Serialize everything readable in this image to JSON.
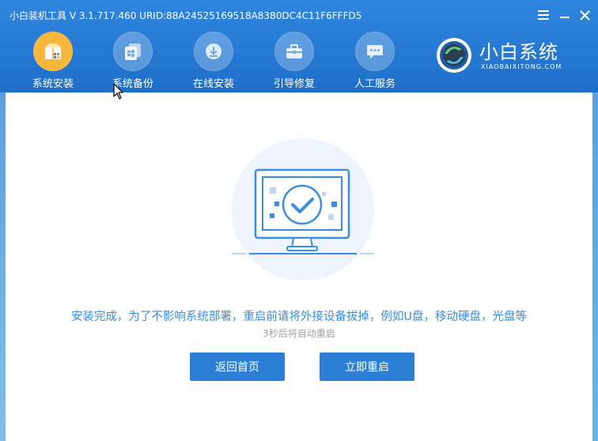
{
  "window": {
    "title": "小白装机工具 V 3.1.717.460 URID:88A24525169518A8380DC4C11F6FFFD5",
    "menu_icon": "menu-icon",
    "minimize_icon": "minimize-icon",
    "close_icon": "close-icon"
  },
  "nav": {
    "items": [
      {
        "label": "系统安装",
        "icon": "box-icon",
        "active": true
      },
      {
        "label": "系统备份",
        "icon": "windows-copy-icon",
        "active": false
      },
      {
        "label": "在线安装",
        "icon": "download-icon",
        "active": false
      },
      {
        "label": "引导修复",
        "icon": "toolbox-icon",
        "active": false
      },
      {
        "label": "人工服务",
        "icon": "chat-icon",
        "active": false
      }
    ]
  },
  "brand": {
    "name": "小白系统",
    "subtitle": "XIAOBAIXITONG.COM"
  },
  "main": {
    "message": "安装完成，为了不影响系统部署，重启前请将外接设备拔掉，例如U盘，移动硬盘，光盘等",
    "countdown": "3秒后将自动重启",
    "back_button": "返回首页",
    "restart_button": "立即重启"
  },
  "colors": {
    "header": "#2a7fd8",
    "accent": "#3a8ee0",
    "button": "#2d7fd6",
    "active_icon": "#f6b73c"
  }
}
